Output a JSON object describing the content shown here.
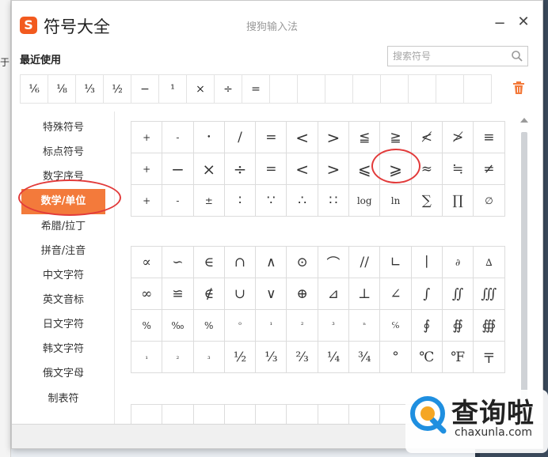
{
  "background": {
    "left_fragment": "于"
  },
  "window": {
    "logo_letter": "S",
    "title": "符号大全",
    "subtitle": "搜狗输入法",
    "minimize_label": "−",
    "close_label": "✕"
  },
  "recent": {
    "label": "最近使用",
    "symbols": [
      "⅙",
      "⅛",
      "⅓",
      "½",
      "−",
      "¹",
      "×",
      "÷",
      "=",
      "",
      "",
      "",
      "",
      "",
      "",
      "",
      ""
    ]
  },
  "search": {
    "placeholder": "搜索符号"
  },
  "sidebar": {
    "items": [
      {
        "label": "特殊符号"
      },
      {
        "label": "标点符号"
      },
      {
        "label": "数字序号"
      },
      {
        "label": "数学/单位",
        "active": true
      },
      {
        "label": "希腊/拉丁"
      },
      {
        "label": "拼音/注音"
      },
      {
        "label": "中文字符"
      },
      {
        "label": "英文音标"
      },
      {
        "label": "日文字符"
      },
      {
        "label": "韩文字符"
      },
      {
        "label": "俄文字母"
      },
      {
        "label": "制表符"
      }
    ]
  },
  "symbol_grid_1": [
    "+",
    "-",
    "•",
    "/",
    "=",
    "<",
    ">",
    "≦",
    "≧",
    "≮",
    "≯",
    "≡",
    "+",
    "−",
    "×",
    "÷",
    "=",
    "<",
    ">",
    "⩽",
    "⩾",
    "≈",
    "≒",
    "≠",
    "+",
    "-",
    "±",
    "∶",
    "∵",
    "∴",
    "∷",
    "log",
    "ln",
    "∑",
    "∏",
    "∅"
  ],
  "symbol_grid_2": [
    "∝",
    "∽",
    "∈",
    "∩",
    "∧",
    "⊙",
    "⌒",
    "//",
    "∟",
    "∣",
    "∂",
    "∆",
    "∞",
    "≌",
    "∉",
    "∪",
    "∨",
    "⊕",
    "⊿",
    "⊥",
    "∠",
    "∫",
    "∬",
    "∭",
    "%",
    "‰",
    "%",
    "⁰",
    "¹",
    "²",
    "³",
    "ⁿ",
    "℅",
    "∮",
    "∯",
    "∰",
    "₁",
    "₂",
    "₃",
    "½",
    "⅓",
    "⅔",
    "¼",
    "¾",
    "°",
    "℃",
    "℉",
    "〒"
  ],
  "watermark": {
    "text": "查询啦",
    "domain": "chaxunla.com"
  },
  "colors": {
    "accent": "#f37a3b",
    "logo": "#f25a1f",
    "annotation": "#e23b3b"
  }
}
